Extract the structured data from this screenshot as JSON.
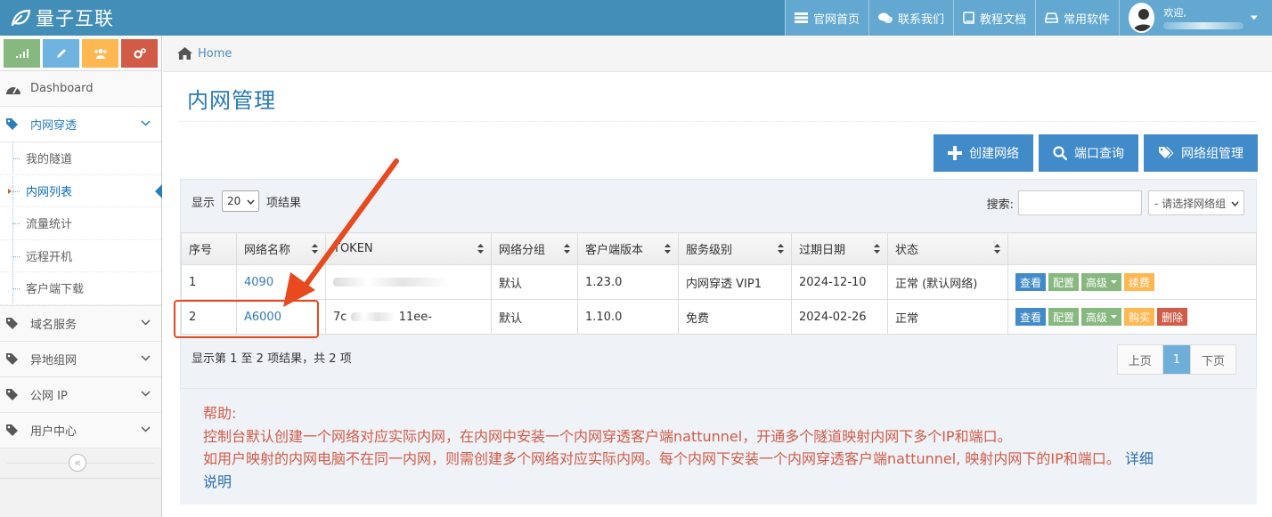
{
  "brand": {
    "title": "量子互联"
  },
  "topnav": {
    "items": [
      {
        "label": "官网首页",
        "icon": "list-icon"
      },
      {
        "label": "联系我们",
        "icon": "chat-icon"
      },
      {
        "label": "教程文档",
        "icon": "book-icon"
      },
      {
        "label": "常用软件",
        "icon": "drive-icon"
      }
    ],
    "welcome": "欢迎,"
  },
  "sidebar": {
    "menu": [
      {
        "label": "Dashboard",
        "icon": "dashboard-icon"
      },
      {
        "label": "内网穿透",
        "icon": "tag-icon",
        "expanded": true
      },
      {
        "label": "域名服务",
        "icon": "tag-icon"
      },
      {
        "label": "异地组网",
        "icon": "tag-icon"
      },
      {
        "label": "公网 IP",
        "icon": "tag-icon"
      },
      {
        "label": "用户中心",
        "icon": "tag-icon"
      }
    ],
    "submenu": [
      {
        "label": "我的隧道"
      },
      {
        "label": "内网列表",
        "active": true
      },
      {
        "label": "流量统计"
      },
      {
        "label": "远程开机"
      },
      {
        "label": "客户端下载"
      }
    ]
  },
  "breadcrumb": {
    "home": "Home"
  },
  "page": {
    "title": "内网管理"
  },
  "toolbar": {
    "create": "创建网络",
    "port_query": "端口查询",
    "group_manage": "网络组管理"
  },
  "table_controls": {
    "show_prefix": "显示",
    "page_size": "20",
    "show_suffix": "项结果",
    "search_label": "搜索:",
    "group_placeholder": "- 请选择网络组"
  },
  "table": {
    "headers": [
      "序号",
      "网络名称",
      "TOKEN",
      "网络分组",
      "客户端版本",
      "服务级别",
      "过期日期",
      "状态",
      ""
    ],
    "rows": [
      {
        "index": "1",
        "name": "4090",
        "token_visible": "",
        "group": "默认",
        "client_version": "1.23.0",
        "service_level": "内网穿透 VIP1",
        "expiry": "2024-12-10",
        "status": "正常 (默认网络)",
        "actions": [
          "查看",
          "配置",
          "高级",
          "续费"
        ]
      },
      {
        "index": "2",
        "name": "A6000",
        "token_visible": "7c",
        "token_visible_tail": "11ee-",
        "group": "默认",
        "client_version": "1.10.0",
        "service_level": "免费",
        "expiry": "2024-02-26",
        "status": "正常",
        "actions": [
          "查看",
          "配置",
          "高级",
          "购买",
          "删除"
        ]
      }
    ],
    "info": "显示第 1 至 2 项结果，共 2 项"
  },
  "pagination": {
    "prev": "上页",
    "current": "1",
    "next": "下页"
  },
  "help": {
    "title": "帮助:",
    "line1": "控制台默认创建一个网络对应实际内网，在内网中安装一个内网穿透客户端nattunnel，开通多个隧道映射内网下多个IP和端口。",
    "line2": "如用户映射的内网电脑不在同一内网，则需创建多个网络对应实际内网。每个内网下安装一个内网穿透客户端nattunnel, 映射内网下的IP和端口。",
    "detail_link_a": "详细",
    "detail_link_b": "说明"
  },
  "colors": {
    "navbar": "#438eb9",
    "nav_item": "#62a8d1",
    "primary_btn": "#428bca",
    "green": "#87b87f",
    "yellow": "#ffb752",
    "red": "#d15b47",
    "annotation": "#e8491e"
  }
}
